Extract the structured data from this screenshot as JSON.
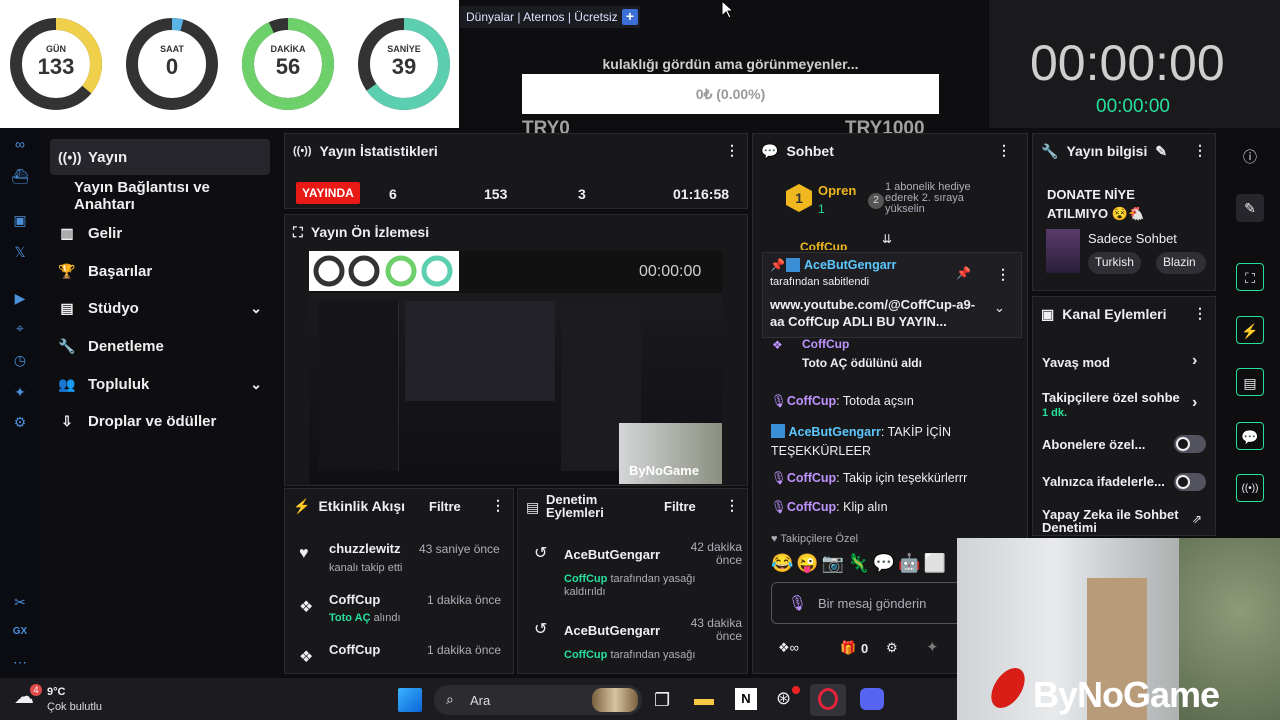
{
  "countdown": {
    "rings": [
      {
        "label": "GÜN",
        "value": "133",
        "fraction": 0.36,
        "color": "#f0d04a"
      },
      {
        "label": "SAAT",
        "value": "0",
        "fraction": 0.04,
        "color": "#5ab4e6"
      },
      {
        "label": "DAKİKA",
        "value": "56",
        "fraction": 0.93,
        "color": "#6ed06a"
      },
      {
        "label": "SANİYE",
        "value": "39",
        "fraction": 0.65,
        "color": "#5ccfb1"
      }
    ]
  },
  "browser": {
    "tabs_text": "Dünyalar | Aternos | Ücretsiz"
  },
  "goal": {
    "title": "kulaklığı gördün ama görünmeyenler...",
    "progress_text": "0₺ (0.00%)",
    "min_label": "TRY0",
    "max_label": "TRY1000"
  },
  "timers": {
    "big": "00:00:00",
    "small": "00:00:00"
  },
  "sidebar": {
    "items": [
      {
        "label": "Yayın",
        "icon": "broadcast-icon"
      },
      {
        "label": "Yayın Bağlantısı ve Anahtarı",
        "icon": ""
      },
      {
        "label": "Gelir",
        "icon": "chart-icon"
      },
      {
        "label": "Başarılar",
        "icon": "trophy-icon"
      },
      {
        "label": "Stüdyo",
        "icon": "studio-icon"
      },
      {
        "label": "Denetleme",
        "icon": "wrench-icon"
      },
      {
        "label": "Topluluk",
        "icon": "community-icon"
      },
      {
        "label": "Droplar ve ödüller",
        "icon": "drops-icon"
      }
    ]
  },
  "stats": {
    "title": "Yayın İstatistikleri",
    "live_label": "YAYINDA",
    "viewers": "6",
    "followers": "153",
    "subs": "3",
    "uptime": "01:16:58"
  },
  "preview": {
    "title": "Yayın Ön İzlemesi",
    "overlay_timer": "00:00:00",
    "watermark": "ByNoGame"
  },
  "activity": {
    "title": "Etkinlik Akışı",
    "filter": "Filtre",
    "items": [
      {
        "user": "chuzzlewitz",
        "time": "43 saniye önce",
        "desc": "kanalı takip etti"
      },
      {
        "user": "CoffCup",
        "time": "1 dakika önce",
        "highlight": "Toto AÇ",
        "desc": "alındı"
      },
      {
        "user": "CoffCup",
        "time": "1 dakika önce",
        "highlight": "",
        "desc": ""
      }
    ]
  },
  "modactions": {
    "title": "Denetim Eylemleri",
    "filter": "Filtre",
    "items": [
      {
        "user": "AceButGengarr",
        "time": "42 dakika önce",
        "actor": "CoffCup",
        "desc": "tarafından yasağı kaldırıldı"
      },
      {
        "user": "AceButGengarr",
        "time": "43 dakika önce",
        "actor": "CoffCup",
        "desc": "tarafından yasağı"
      }
    ]
  },
  "chat": {
    "title": "Sohbet",
    "top_user": "Opren",
    "top_count": "1",
    "gift_text": "1 abonelik hediye ederek 2. sıraya yükselin",
    "pinned_user": "AceButGengarr",
    "pinned_by": "tarafından sabitlendi",
    "pinned_msg": "www.youtube.com/@CoffCup-a9-aa CoffCup ADLI BU YAYIN...",
    "partial_user": "CoffCup",
    "messages": [
      {
        "user": "CoffCup",
        "text": "Toto AÇ ödülünü aldı",
        "type": "reward"
      },
      {
        "user": "CoffCup",
        "text": ": Totoda açsın",
        "type": "msg"
      },
      {
        "user": "AceButGengarr",
        "text": ": TAKİP İÇİN TEŞEKKÜRLEER",
        "type": "mod"
      },
      {
        "user": "CoffCup",
        "text": ": Takip için teşekkürlerrr",
        "type": "msg"
      },
      {
        "user": "CoffCup",
        "text": ": Klip alın",
        "type": "msg"
      }
    ],
    "followers_only": "Takipçilere Özel",
    "input_placeholder": "Bir mesaj gönderin",
    "points": "0"
  },
  "streaminfo": {
    "title": "Yayın bilgisi",
    "stream_title": "DONATE NİYE ATILMIYO 😵🐔",
    "category": "Sadece Sohbet",
    "tags": [
      "Turkish",
      "Blazin"
    ]
  },
  "channel": {
    "title": "Kanal Eylemleri",
    "items": [
      {
        "label": "Yavaş mod",
        "sub": "",
        "control": "chevron"
      },
      {
        "label": "Takipçilere özel sohbe",
        "sub": "1 dk.",
        "control": "chevron"
      },
      {
        "label": "Abonelere özel...",
        "sub": "",
        "control": "toggle"
      },
      {
        "label": "Yalnızca ifadelerle...",
        "sub": "",
        "control": "toggle"
      },
      {
        "label": "Yapay Zeka ile Sohbet Denetimi",
        "sub": "",
        "control": "external"
      }
    ]
  },
  "webcam": {
    "watermark": "ByNoGame"
  },
  "taskbar": {
    "temp": "9°C",
    "weather": "Çok bulutlu",
    "search_placeholder": "Ara",
    "weather_badge": "4"
  },
  "colors": {
    "accent": "#9147ff",
    "live": "#e91916",
    "green": "#27e09a",
    "chat_purple": "#bf94ff"
  }
}
